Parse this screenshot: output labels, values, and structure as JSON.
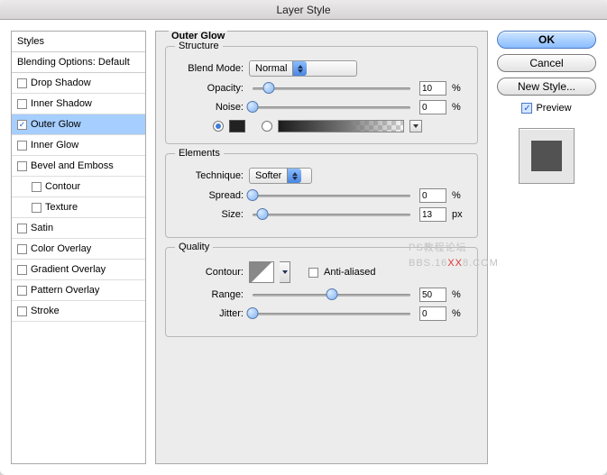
{
  "title": "Layer Style",
  "sidebar": {
    "header": "Styles",
    "blending": "Blending Options: Default",
    "items": [
      {
        "label": "Drop Shadow",
        "checked": false
      },
      {
        "label": "Inner Shadow",
        "checked": false
      },
      {
        "label": "Outer Glow",
        "checked": true,
        "selected": true
      },
      {
        "label": "Inner Glow",
        "checked": false
      },
      {
        "label": "Bevel and Emboss",
        "checked": false
      },
      {
        "label": "Contour",
        "checked": false,
        "sub": true
      },
      {
        "label": "Texture",
        "checked": false,
        "sub": true
      },
      {
        "label": "Satin",
        "checked": false
      },
      {
        "label": "Color Overlay",
        "checked": false
      },
      {
        "label": "Gradient Overlay",
        "checked": false
      },
      {
        "label": "Pattern Overlay",
        "checked": false
      },
      {
        "label": "Stroke",
        "checked": false
      }
    ]
  },
  "panel": {
    "title": "Outer Glow",
    "structure": {
      "legend": "Structure",
      "blend_mode_label": "Blend Mode:",
      "blend_mode_value": "Normal",
      "opacity_label": "Opacity:",
      "opacity_value": "10",
      "opacity_unit": "%",
      "noise_label": "Noise:",
      "noise_value": "0",
      "noise_unit": "%"
    },
    "elements": {
      "legend": "Elements",
      "technique_label": "Technique:",
      "technique_value": "Softer",
      "spread_label": "Spread:",
      "spread_value": "0",
      "spread_unit": "%",
      "size_label": "Size:",
      "size_value": "13",
      "size_unit": "px"
    },
    "quality": {
      "legend": "Quality",
      "contour_label": "Contour:",
      "anti_label": "Anti-aliased",
      "range_label": "Range:",
      "range_value": "50",
      "range_unit": "%",
      "jitter_label": "Jitter:",
      "jitter_value": "0",
      "jitter_unit": "%"
    }
  },
  "buttons": {
    "ok": "OK",
    "cancel": "Cancel",
    "new_style": "New Style...",
    "preview": "Preview"
  },
  "watermark": {
    "a": "PS教程论坛",
    "b": "BBS.16",
    "c": "XX",
    "d": "8.COM"
  }
}
